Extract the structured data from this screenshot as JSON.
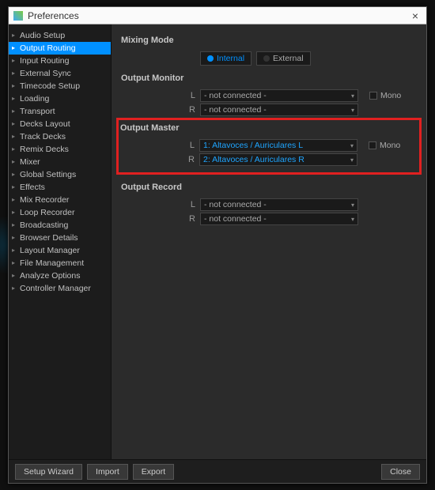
{
  "window": {
    "title": "Preferences"
  },
  "sidebar": {
    "items": [
      {
        "label": "Audio Setup"
      },
      {
        "label": "Output Routing"
      },
      {
        "label": "Input Routing"
      },
      {
        "label": "External Sync"
      },
      {
        "label": "Timecode Setup"
      },
      {
        "label": "Loading"
      },
      {
        "label": "Transport"
      },
      {
        "label": "Decks Layout"
      },
      {
        "label": "Track Decks"
      },
      {
        "label": "Remix Decks"
      },
      {
        "label": "Mixer"
      },
      {
        "label": "Global Settings"
      },
      {
        "label": "Effects"
      },
      {
        "label": "Mix Recorder"
      },
      {
        "label": "Loop Recorder"
      },
      {
        "label": "Broadcasting"
      },
      {
        "label": "Browser Details"
      },
      {
        "label": "Layout Manager"
      },
      {
        "label": "File Management"
      },
      {
        "label": "Analyze Options"
      },
      {
        "label": "Controller Manager"
      }
    ],
    "selected_index": 1
  },
  "mixing_mode": {
    "title": "Mixing Mode",
    "options": [
      {
        "label": "Internal",
        "active": true
      },
      {
        "label": "External",
        "active": false
      }
    ]
  },
  "output_monitor": {
    "title": "Output Monitor",
    "L": "- not connected -",
    "R": "- not connected -",
    "mono_label": "Mono"
  },
  "output_master": {
    "title": "Output Master",
    "L": "1: Altavoces / Auriculares L",
    "R": "2: Altavoces / Auriculares R",
    "mono_label": "Mono"
  },
  "output_record": {
    "title": "Output Record",
    "L": "- not connected -",
    "R": "- not connected -"
  },
  "footer": {
    "setup_wizard": "Setup Wizard",
    "import": "Import",
    "export": "Export",
    "close": "Close"
  },
  "labels": {
    "L": "L",
    "R": "R"
  }
}
